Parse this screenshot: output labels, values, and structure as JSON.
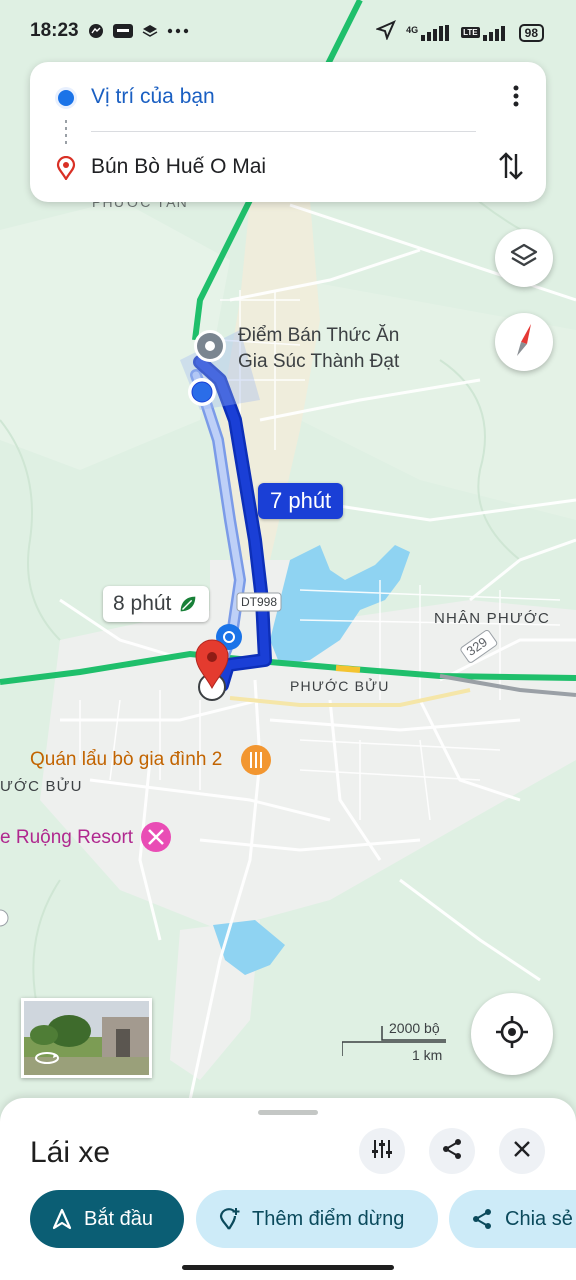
{
  "status_bar": {
    "time": "18:23",
    "app_icons": [
      "messenger-icon",
      "zalo-icon",
      "layers-app-icon",
      "more-dots-icon"
    ],
    "network_label": "4G",
    "lte_label": "LTE",
    "battery": "98"
  },
  "route": {
    "origin": "Vị trí của bạn",
    "destination": "Bún Bò Huế O Mai"
  },
  "map": {
    "labels": {
      "poi_feed_store_line1": "Điểm Bán Thức Ăn",
      "poi_feed_store_line2": "Gia Súc Thành Đạt",
      "area_phuoc_tan": "PHƯỚC TÂN",
      "area_nhan_phuoc": "NHÂN PHƯỚC",
      "area_phuoc_buu": "PHƯỚC BỬU",
      "area_phuoc_buu_left": "ƯỚC BỬU",
      "poi_restaurant": "Quán lẩu bò gia đình 2",
      "poi_resort": "e Ruộng Resort",
      "road_329": "329",
      "road_dt998": "DT998"
    },
    "route_times": {
      "primary": "7 phút",
      "alternative": "8 phút"
    },
    "scale": {
      "imperial": "2000 bộ",
      "metric": "1 km"
    },
    "colors": {
      "route_primary": "#1a3fd6",
      "route_alt": "#a9c1f5",
      "highway_green": "#1fbf6b",
      "water": "#8fd3f2",
      "land": "#dff0e3",
      "urban": "#f1f3f4"
    }
  },
  "bottom_sheet": {
    "title": "Lái xe",
    "buttons": {
      "start": "Bắt đầu",
      "add_stop": "Thêm điểm dừng",
      "share": "Chia sẻ"
    }
  }
}
